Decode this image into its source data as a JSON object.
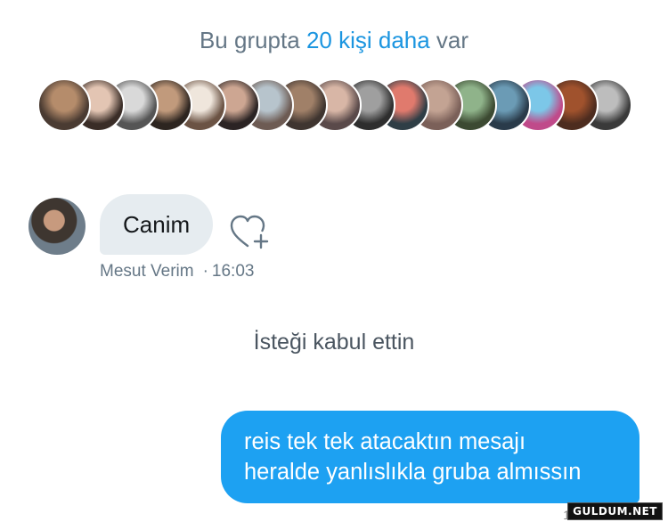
{
  "group_info": {
    "prefix": "Bu grupta ",
    "link": "20 kişi daha",
    "suffix": " var"
  },
  "member_avatars": [
    {
      "name": "member-avatar",
      "colors": [
        "#b58c6b",
        "#4a3b32"
      ]
    },
    {
      "name": "member-avatar",
      "colors": [
        "#e3c5b3",
        "#3a2d27"
      ]
    },
    {
      "name": "member-avatar",
      "colors": [
        "#d9d9d9",
        "#555555"
      ]
    },
    {
      "name": "member-avatar",
      "colors": [
        "#c19a7c",
        "#2d2520"
      ]
    },
    {
      "name": "member-avatar",
      "colors": [
        "#efe6dc",
        "#6b5344"
      ]
    },
    {
      "name": "member-avatar",
      "colors": [
        "#cda692",
        "#2b2424"
      ]
    },
    {
      "name": "member-avatar",
      "colors": [
        "#b7c4cc",
        "#6d5b53"
      ]
    },
    {
      "name": "member-avatar",
      "colors": [
        "#a08068",
        "#3f3530"
      ]
    },
    {
      "name": "member-avatar",
      "colors": [
        "#d8b6a6",
        "#5a4a4a"
      ]
    },
    {
      "name": "member-avatar",
      "colors": [
        "#9f9f9f",
        "#2e2e2e"
      ]
    },
    {
      "name": "member-avatar",
      "colors": [
        "#e07a6d",
        "#2f3e46"
      ]
    },
    {
      "name": "member-avatar",
      "colors": [
        "#c3a393",
        "#7b6059"
      ]
    },
    {
      "name": "member-avatar",
      "colors": [
        "#8fb38a",
        "#3c4a32"
      ]
    },
    {
      "name": "member-avatar",
      "colors": [
        "#6b9bb5",
        "#2a3b4a"
      ]
    },
    {
      "name": "member-avatar",
      "colors": [
        "#7cc7e8",
        "#c04a8a"
      ]
    },
    {
      "name": "member-avatar",
      "colors": [
        "#a0522d",
        "#4d2c1f"
      ]
    },
    {
      "name": "member-avatar",
      "colors": [
        "#bdbdbd",
        "#3a3a3a"
      ]
    }
  ],
  "incoming_message": {
    "text": "Canim",
    "sender": "Mesut Verim",
    "separator": "·",
    "time": "16:03"
  },
  "system_message": "İsteği kabul ettin",
  "outgoing_message": {
    "line1": "reis tek tek atacaktın mesajı",
    "line2": "heralde yanlıslıkla gruba almıssın"
  },
  "watermark": "GULDUM.NET",
  "partial_timestamp": "1",
  "colors": {
    "accent": "#1da1f2",
    "link": "#1b95e0",
    "muted": "#657786",
    "incoming_bubble": "#e6ecf0"
  },
  "icons": {
    "like": "heart-plus-icon"
  }
}
